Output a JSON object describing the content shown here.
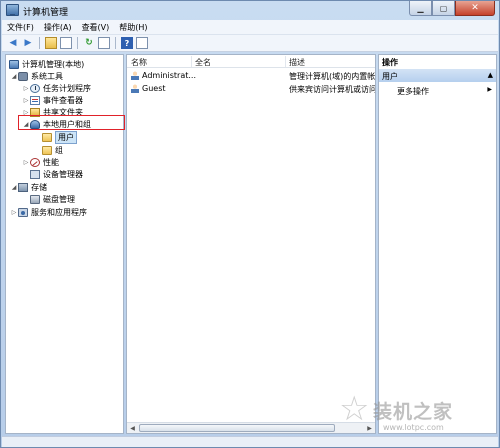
{
  "window": {
    "title": "计算机管理"
  },
  "menu": [
    "文件(F)",
    "操作(A)",
    "查看(V)",
    "帮助(H)"
  ],
  "tree": {
    "root": "计算机管理(本地)",
    "system_tools": "系统工具",
    "task_scheduler": "任务计划程序",
    "event_viewer": "事件查看器",
    "shared_folders": "共享文件夹",
    "local_users_groups": "本地用户和组",
    "users": "用户",
    "groups": "组",
    "performance": "性能",
    "device_manager": "设备管理器",
    "storage": "存储",
    "disk_management": "磁盘管理",
    "services_apps": "服务和应用程序"
  },
  "list": {
    "columns": [
      "名称",
      "全名",
      "描述"
    ],
    "rows": [
      {
        "name": "Administrat...",
        "fullname": "",
        "description": "管理计算机(域)的内置帐户"
      },
      {
        "name": "Guest",
        "fullname": "",
        "description": "供来宾访问计算机或访问域"
      }
    ]
  },
  "actions": {
    "header": "操作",
    "section": "用户",
    "more": "更多操作"
  },
  "watermark": {
    "text": "装机之家",
    "url": "www.lotpc.com"
  }
}
